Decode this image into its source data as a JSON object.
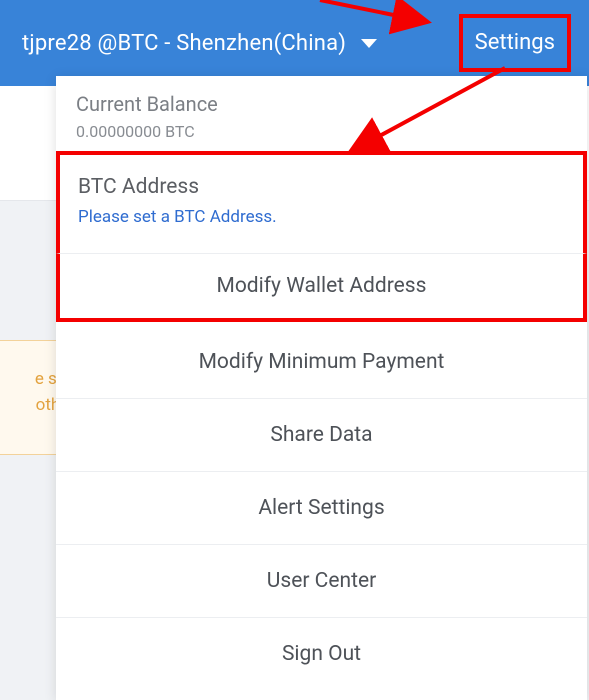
{
  "header": {
    "account_label": "tjpre28 @BTC - Shenzhen(China)",
    "settings_label": "Settings"
  },
  "dropdown": {
    "balance_label": "Current Balance",
    "balance_value": "0.00000000 BTC",
    "address_label": "BTC Address",
    "address_prompt": "Please set a BTC Address.",
    "menu": [
      "Modify Wallet Address",
      "Modify Minimum Payment",
      "Share Data",
      "Alert Settings",
      "User Center",
      "Sign Out"
    ]
  },
  "side_panel": {
    "line1": "e suba",
    "line2": "other r"
  },
  "annotation": {
    "arrows": [
      "arrow-to-settings",
      "arrow-to-address"
    ]
  }
}
